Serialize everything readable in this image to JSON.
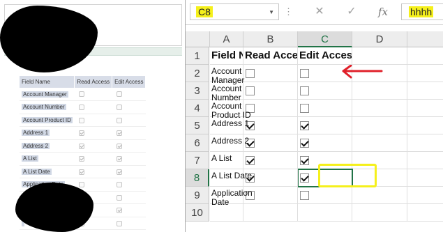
{
  "left_form": {
    "headers": {
      "field": "Field Name",
      "read": "Read Access",
      "edit": "Edit Access"
    },
    "rows": [
      {
        "label": "Account Manager",
        "read": false,
        "edit": false
      },
      {
        "label": "Account Number",
        "read": false,
        "edit": false
      },
      {
        "label": "Account Product ID",
        "read": false,
        "edit": false
      },
      {
        "label": "Address 1",
        "read": true,
        "edit": true
      },
      {
        "label": "Address 2",
        "read": true,
        "edit": true
      },
      {
        "label": "A List",
        "read": true,
        "edit": true
      },
      {
        "label": "A List Date",
        "read": true,
        "edit": true
      },
      {
        "label": "Application Date",
        "read": false,
        "edit": false
      },
      {
        "label": "",
        "read": false,
        "edit": false
      },
      {
        "label": "",
        "read": true,
        "edit": true
      },
      {
        "label": "",
        "read": false,
        "edit": false
      }
    ]
  },
  "excel": {
    "name_box": "C8",
    "formula_value": "hhhh",
    "icons": {
      "cancel": "close-icon",
      "enter": "check-icon",
      "function": "fx-icon"
    },
    "fx_label": "fx",
    "columns": [
      "A",
      "B",
      "C",
      "D"
    ],
    "rows": [
      "1",
      "2",
      "3",
      "4",
      "5",
      "6",
      "7",
      "8",
      "9",
      "10"
    ],
    "header_row": {
      "A": "Field Name",
      "B": "Read Access",
      "C": "Edit Access"
    },
    "data_rows": [
      {
        "label": "Account Manager",
        "read": false,
        "edit": false
      },
      {
        "label": "Account Number",
        "read": false,
        "edit": false
      },
      {
        "label": "Account Product ID",
        "read": false,
        "edit": false
      },
      {
        "label": "Address 1",
        "read": true,
        "edit": true
      },
      {
        "label": "Address 2",
        "read": true,
        "edit": true
      },
      {
        "label": "A List",
        "read": true,
        "edit": true
      },
      {
        "label": "A List Date",
        "read": true,
        "edit": true
      },
      {
        "label": "Application Date",
        "read": false,
        "edit": false
      }
    ],
    "selected_cell": "C8"
  },
  "annotations": {
    "highlight_color": "#f5f01c",
    "arrow_color": "#e0202a"
  }
}
